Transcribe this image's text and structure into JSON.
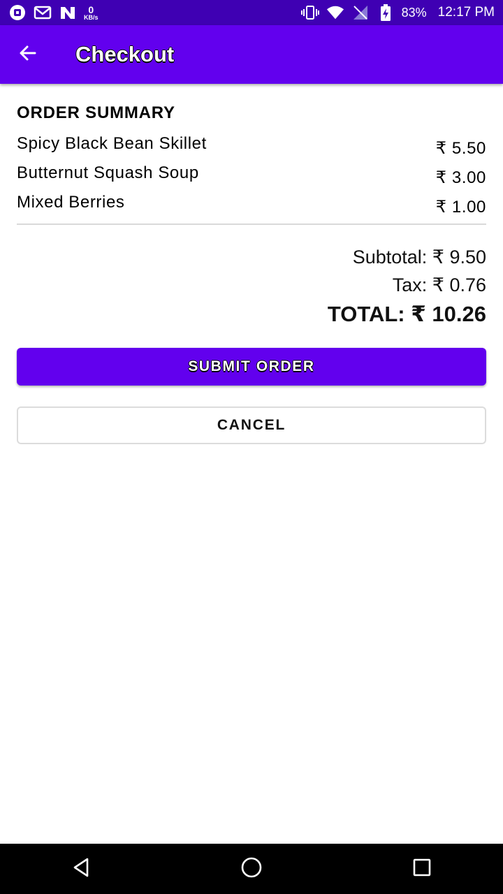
{
  "status_bar": {
    "speed_value": "0",
    "speed_unit": "KB/s",
    "battery": "83%",
    "time": "12:17 PM"
  },
  "app_bar": {
    "title": "Checkout",
    "back_icon": "arrow-back-icon"
  },
  "order_summary": {
    "heading": "ORDER SUMMARY",
    "items": [
      {
        "name": "Spicy Black Bean Skillet",
        "price": "₹ 5.50"
      },
      {
        "name": "Butternut Squash Soup",
        "price": "₹ 3.00"
      },
      {
        "name": "Mixed Berries",
        "price": "₹ 1.00"
      }
    ],
    "subtotal": "Subtotal: ₹ 9.50",
    "tax": "Tax: ₹ 0.76",
    "total": "TOTAL: ₹ 10.26"
  },
  "actions": {
    "submit_label": "SUBMIT ORDER",
    "cancel_label": "CANCEL"
  },
  "colors": {
    "status_bar": "#3f00b3",
    "app_bar": "#6200ee",
    "primary_button": "#6200ee"
  }
}
